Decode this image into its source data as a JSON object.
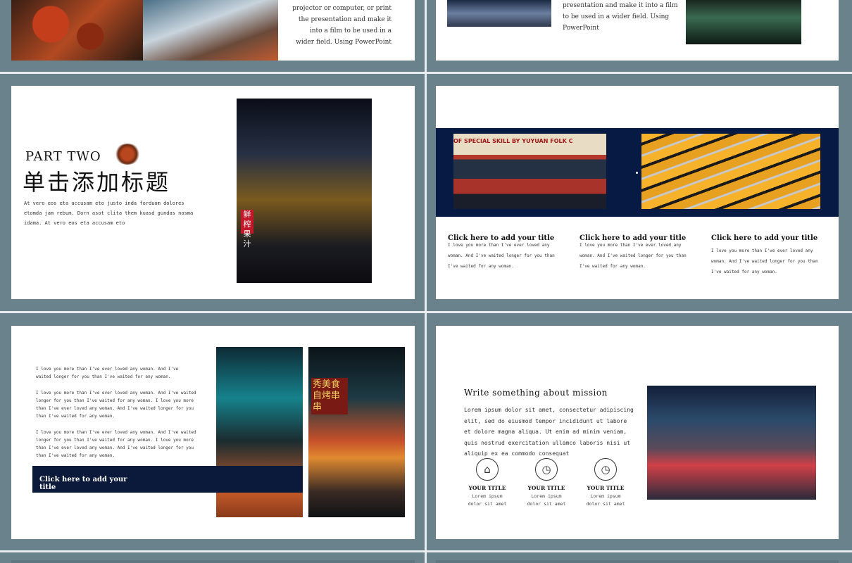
{
  "slide1": {
    "body": "projector or computer, or print the presentation and make it into a film to be used in a wider field. Using PowerPoint"
  },
  "slide2": {
    "body": "presentation and make it into a film to be used in a wider field. Using PowerPoint"
  },
  "slide3": {
    "part": "PART TWO",
    "title": "单击添加标题",
    "body": "At vero eos eta accusam eto justo inda forduom dolores etomda jam rebum. Dorn asot clita them kuasd gundas nosma idama. At vero eos eta accusam eto"
  },
  "slide4": {
    "sign_text": "OF SPECIAL SKILL BY YUYUAN FOLK C",
    "columns": [
      {
        "title": "Click here to add your title",
        "body": "I love you more than I've ever loved any woman. And I've waited longer for you than I've waited for any woman."
      },
      {
        "title": "Click here to add your title",
        "body": "I love you more than I've ever loved any woman. And I've waited longer for you than I've waited for any woman."
      },
      {
        "title": "Click here to add your title",
        "body": "I love you more than I've ever loved any woman. And I've waited longer for you than I've waited for any woman."
      }
    ]
  },
  "slide5": {
    "para1": "I love you more than I've ever loved any woman. And I've waited longer for you than I've waited for any woman.",
    "para2": "I love you more than I've ever loved any woman. And I've waited longer for you than I've waited for any woman. I love you more than I've ever loved any woman. And I've waited longer for you than I've waited for any woman.",
    "para3": "I love you more than I've ever loved any woman. And I've waited longer for you than I've waited for any woman. I love you more than I've ever loved any woman. And I've waited longer for you than I've waited for any woman.",
    "bar_title": "Click here to add your title",
    "sign_text": "秀美食 自烤串串"
  },
  "slide6": {
    "title": "Write something about mission",
    "body": "Lorem ipsum dolor sit amet, consectetur adipiscing elit, sed do eiusmod tempor incididunt ut labore et dolore magna aliqua. Ut enim ad minim veniam, quis nostrud exercitation ullamco laboris nisi ut aliquip ex ea commodo consequat",
    "items": [
      {
        "icon": "home-icon",
        "glyph": "⌂",
        "title": "YOUR TITLE",
        "text": "Lorem ipsum dolor sit amet"
      },
      {
        "icon": "clock-icon",
        "glyph": "◷",
        "title": "YOUR TITLE",
        "text": "Lorem ipsum dolor sit amet"
      },
      {
        "icon": "clock-icon",
        "glyph": "◷",
        "title": "YOUR TITLE",
        "text": "Lorem ipsum dolor sit amet"
      }
    ]
  },
  "colors": {
    "panel": "#6a828c",
    "navy": "#071a44",
    "slide": "#ffffff"
  }
}
